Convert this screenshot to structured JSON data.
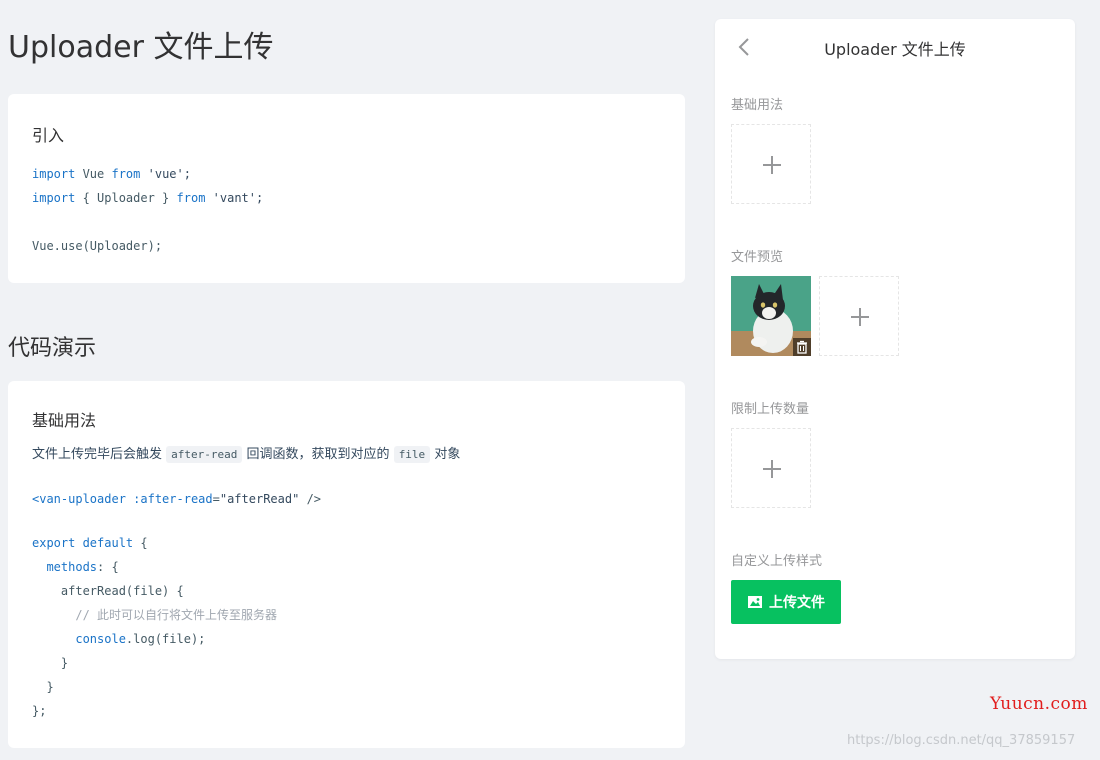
{
  "page": {
    "title": "Uploader 文件上传",
    "section_title": "代码演示"
  },
  "intro": {
    "heading": "引入",
    "code": [
      {
        "kw1": "import",
        "text1": " Vue ",
        "kw2": "from",
        "text2": " 'vue';"
      },
      {
        "kw1": "import",
        "text1": " { Uploader } ",
        "kw2": "from",
        "text2": " 'vant';"
      },
      {
        "kw1": "",
        "text1": "",
        "kw2": "",
        "text2": ""
      },
      {
        "kw1": "",
        "text1": "Vue.use(Uploader);",
        "kw2": "",
        "text2": ""
      }
    ]
  },
  "basic": {
    "heading": "基础用法",
    "desc_before": "文件上传完毕后会触发",
    "desc_code1": "after-read",
    "desc_middle": "回调函数，获取到对应的",
    "desc_code2": "file",
    "desc_after": "对象",
    "template_line": {
      "tag_open": "<van-uploader",
      "attr": " :after-read",
      "eq": "=",
      "value": "\"afterRead\"",
      "tag_close": " />"
    },
    "script_lines": {
      "l1_kw": "export default",
      "l1_rest": " {",
      "l2_kw": "  methods",
      "l2_rest": ": {",
      "l3": "    afterRead(file) {",
      "l4": "      // 此时可以自行将文件上传至服务器",
      "l5_kw": "      console",
      "l5_rest": ".log(file);",
      "l6": "    }",
      "l7": "  }",
      "l8": "};"
    }
  },
  "phone": {
    "nav_title": "Uploader 文件上传",
    "back_icon": "chevron-left-icon",
    "labels": {
      "basic": "基础用法",
      "preview": "文件预览",
      "limit": "限制上传数量",
      "custom": "自定义上传样式"
    },
    "upload_button_label": "上传文件",
    "accent_color": "#07c160"
  },
  "watermark": {
    "brand": "Yuucn.com",
    "url": "https://blog.csdn.net/qq_37859157"
  }
}
